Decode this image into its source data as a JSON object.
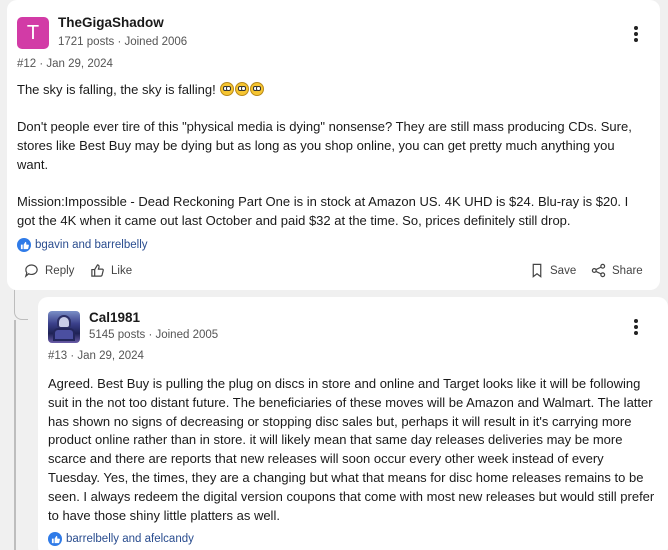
{
  "post1": {
    "avatar_letter": "T",
    "username": "TheGigaShadow",
    "meta": "1721 posts · Joined 2006",
    "postnum": "#12 · Jan 29, 2024",
    "line1": "The sky is falling, the sky is falling!",
    "para2": "Don't people ever tire of this \"physical media is dying\" nonsense? They are still mass producing CDs. Sure, stores like Best Buy may be dying but as long as you shop online, you can get pretty much anything you want.",
    "para3": "Mission:Impossible - Dead Reckoning Part One is in stock at Amazon US. 4K UHD is $24. Blu-ray is $20. I got the 4K when it came out last October and paid $32 at the time. So, prices definitely still drop.",
    "reactions": "bgavin and barrelbelly",
    "reply_label": "Reply",
    "like_label": "Like",
    "save_label": "Save",
    "share_label": "Share"
  },
  "post2": {
    "username": "Cal1981",
    "meta": "5145 posts · Joined 2005",
    "postnum": "#13 · Jan 29, 2024",
    "body": "Agreed. Best Buy is pulling the plug on discs in store and online and Target looks like it will be following suit in the not too distant future. The beneficiaries of these moves will be Amazon and Walmart. The latter has shown no signs of decreasing or stopping disc sales but, perhaps it will result in it's carrying more product online rather than in store. it will likely mean that same day releases deliveries may be more scarce and there are reports that new releases will soon occur every other week instead of every Tuesday. Yes, the times, they are a changing but what that means for disc home releases remains to be seen. I always redeem the digital version coupons that come with most new releases but would still prefer to have those shiny little platters as well.",
    "reactions": "barrelbelly and afelcandy"
  },
  "colors": {
    "avatar_bg": "#d23ba6",
    "like_blue": "#2f7be8",
    "page_bg": "#f0f0f0"
  }
}
